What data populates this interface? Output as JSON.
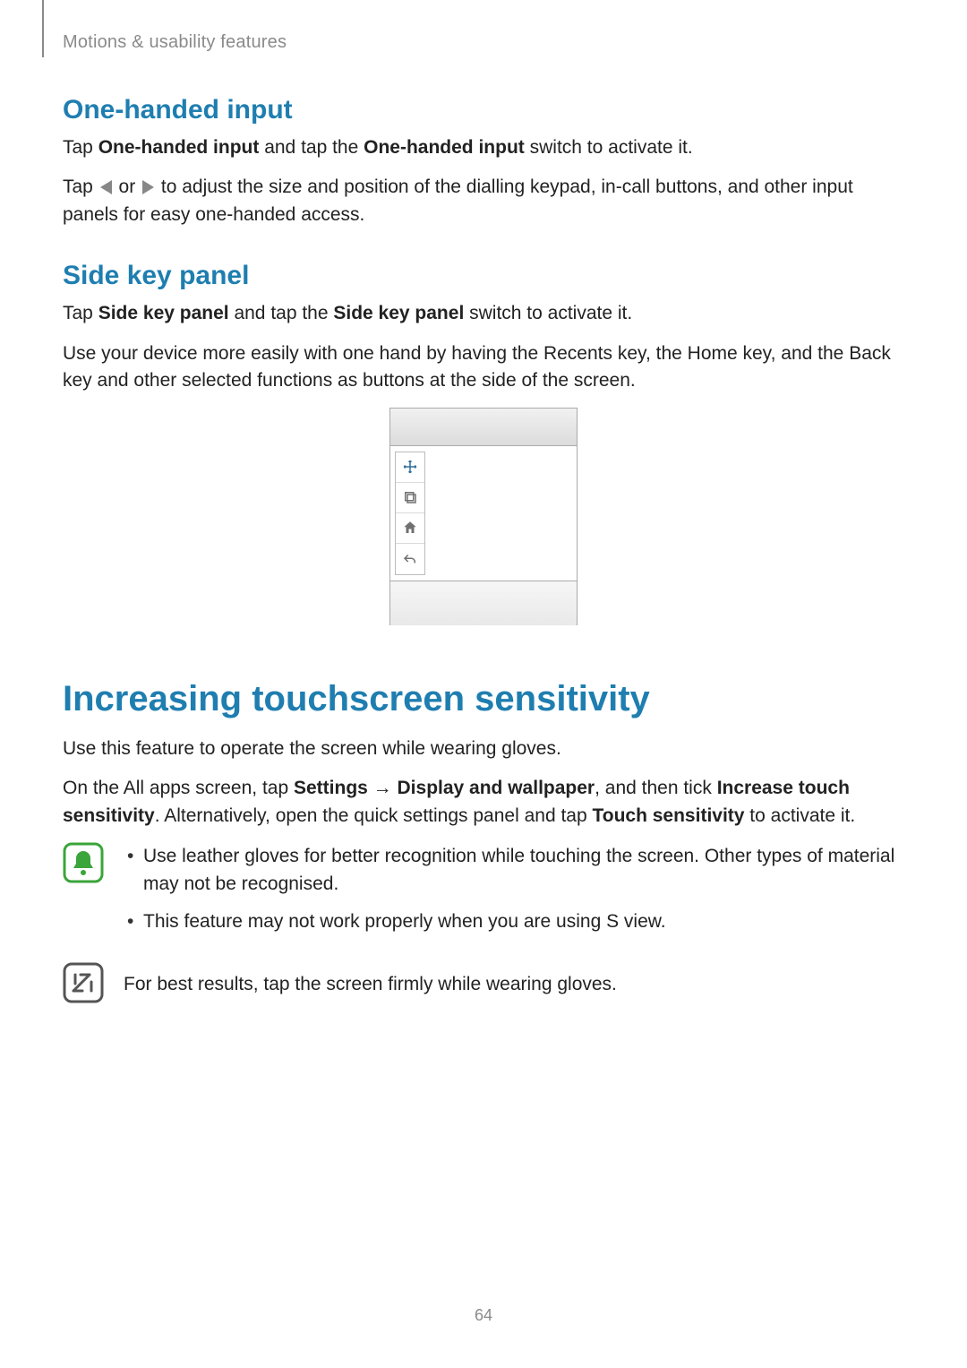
{
  "breadcrumb": "Motions & usability features",
  "page_number": "64",
  "sections": {
    "one_handed": {
      "heading": "One-handed input",
      "p1": {
        "prefix": "Tap ",
        "bold1": "One-handed input",
        "mid": " and tap the ",
        "bold2": "One-handed input",
        "suffix": " switch to activate it."
      },
      "p2": {
        "prefix": "Tap ",
        "mid": " or ",
        "suffix": " to adjust the size and position of the dialling keypad, in-call buttons, and other input panels for easy one-handed access."
      }
    },
    "side_key": {
      "heading": "Side key panel",
      "p1": {
        "prefix": "Tap ",
        "bold1": "Side key panel",
        "mid": " and tap the ",
        "bold2": "Side key panel",
        "suffix": " switch to activate it."
      },
      "p2": "Use your device more easily with one hand by having the Recents key, the Home key, and the Back key and other selected functions as buttons at the side of the screen."
    },
    "sensitivity": {
      "heading": "Increasing touchscreen sensitivity",
      "p1": "Use this feature to operate the screen while wearing gloves.",
      "p2": {
        "t1": "On the All apps screen, tap ",
        "b1": "Settings",
        "t2": " → ",
        "b2": "Display and wallpaper",
        "t3": ", and then tick ",
        "b3": "Increase touch sensitivity",
        "t4": ". Alternatively, open the quick settings panel and tap ",
        "b4": "Touch sensitivity",
        "t5": " to activate it."
      },
      "bullets": [
        "Use leather gloves for better recognition while touching the screen. Other types of material may not be recognised.",
        "This feature may not work properly when you are using S view."
      ],
      "note": "For best results, tap the screen firmly while wearing gloves."
    }
  }
}
